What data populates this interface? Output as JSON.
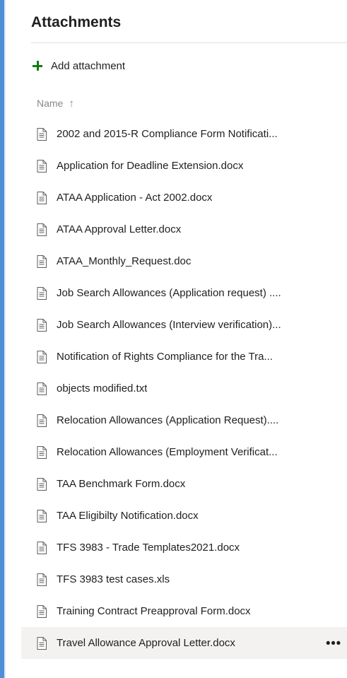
{
  "panel": {
    "title": "Attachments",
    "add_label": "Add attachment",
    "column_header": "Name",
    "sort_icon": "arrow-up-icon"
  },
  "files": [
    {
      "name": "2002 and 2015-R Compliance Form Notificati..."
    },
    {
      "name": "Application for Deadline Extension.docx"
    },
    {
      "name": "ATAA Application - Act 2002.docx"
    },
    {
      "name": "ATAA Approval Letter.docx"
    },
    {
      "name": "ATAA_Monthly_Request.doc"
    },
    {
      "name": "Job Search Allowances (Application request) ...."
    },
    {
      "name": "Job Search Allowances (Interview verification)..."
    },
    {
      "name": "Notification of Rights Compliance for the Tra..."
    },
    {
      "name": "objects modified.txt"
    },
    {
      "name": "Relocation Allowances (Application Request)...."
    },
    {
      "name": "Relocation Allowances (Employment Verificat..."
    },
    {
      "name": "TAA Benchmark Form.docx"
    },
    {
      "name": "TAA Eligibilty Notification.docx"
    },
    {
      "name": "TFS 3983 - Trade Templates2021.docx"
    },
    {
      "name": "TFS 3983 test cases.xls"
    },
    {
      "name": "Training Contract Preapproval Form.docx"
    },
    {
      "name": "Travel Allowance Approval Letter.docx",
      "selected": true
    }
  ],
  "more_label": "•••",
  "colors": {
    "accent_border": "#4f8fd6",
    "add_icon": "#107c10",
    "selected_row": "#f3f2f1"
  }
}
